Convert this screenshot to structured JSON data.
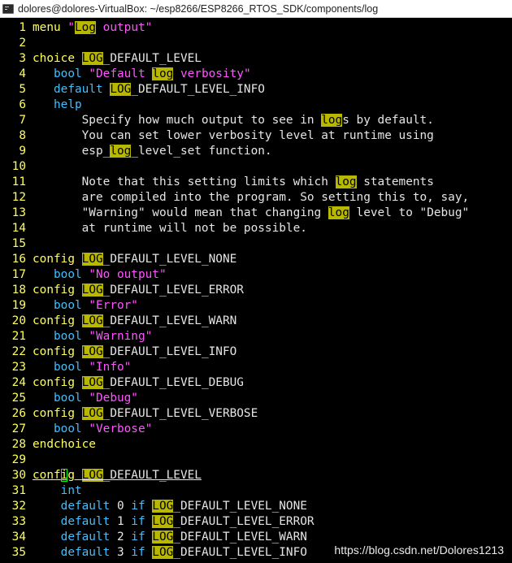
{
  "window": {
    "title": "dolores@dolores-VirtualBox: ~/esp8266/ESP8266_RTOS_SDK/components/log",
    "icon": "terminal-icon"
  },
  "watermark": "https://blog.csdn.net/Dolores1213",
  "colors": {
    "background": "#000000",
    "line_number": "#ffff55",
    "search_highlight_bg": "#b8b800",
    "string": "#ff55ff",
    "keyword": "#ffff55",
    "type": "#3fbfff",
    "text": "#e5e5e5"
  },
  "search_term": "log",
  "lines": [
    {
      "n": "1",
      "segs": [
        {
          "c": "key",
          "t": "menu "
        },
        {
          "c": "str",
          "t": "\""
        },
        {
          "c": "hl",
          "t": "Log"
        },
        {
          "c": "str",
          "t": " output\""
        }
      ]
    },
    {
      "n": "2",
      "segs": []
    },
    {
      "n": "3",
      "segs": [
        {
          "c": "key",
          "t": "choice "
        },
        {
          "c": "hl",
          "t": "LOG"
        },
        {
          "c": "text",
          "t": "_DEFAULT_LEVEL"
        }
      ]
    },
    {
      "n": "4",
      "segs": [
        {
          "c": "text",
          "t": "   "
        },
        {
          "c": "type",
          "t": "bool "
        },
        {
          "c": "str",
          "t": "\"Default "
        },
        {
          "c": "hl",
          "t": "log"
        },
        {
          "c": "str",
          "t": " verbosity\""
        }
      ]
    },
    {
      "n": "5",
      "segs": [
        {
          "c": "text",
          "t": "   "
        },
        {
          "c": "type",
          "t": "default "
        },
        {
          "c": "hl",
          "t": "LOG"
        },
        {
          "c": "text",
          "t": "_DEFAULT_LEVEL_INFO"
        }
      ]
    },
    {
      "n": "6",
      "segs": [
        {
          "c": "text",
          "t": "   "
        },
        {
          "c": "type",
          "t": "help"
        }
      ]
    },
    {
      "n": "7",
      "segs": [
        {
          "c": "text",
          "t": "       Specify how much output to see in "
        },
        {
          "c": "hl",
          "t": "log"
        },
        {
          "c": "text",
          "t": "s by default."
        }
      ]
    },
    {
      "n": "8",
      "segs": [
        {
          "c": "text",
          "t": "       You can set lower verbosity level at runtime using"
        }
      ]
    },
    {
      "n": "9",
      "segs": [
        {
          "c": "text",
          "t": "       esp_"
        },
        {
          "c": "hl",
          "t": "log"
        },
        {
          "c": "text",
          "t": "_level_set function."
        }
      ]
    },
    {
      "n": "10",
      "segs": []
    },
    {
      "n": "11",
      "segs": [
        {
          "c": "text",
          "t": "       Note that this setting limits which "
        },
        {
          "c": "hl",
          "t": "log"
        },
        {
          "c": "text",
          "t": " statements"
        }
      ]
    },
    {
      "n": "12",
      "segs": [
        {
          "c": "text",
          "t": "       are compiled into the program. So setting this to, say,"
        }
      ]
    },
    {
      "n": "13",
      "segs": [
        {
          "c": "text",
          "t": "       \"Warning\" would mean that changing "
        },
        {
          "c": "hl",
          "t": "log"
        },
        {
          "c": "text",
          "t": " level to \"Debug\""
        }
      ]
    },
    {
      "n": "14",
      "segs": [
        {
          "c": "text",
          "t": "       at runtime will not be possible."
        }
      ]
    },
    {
      "n": "15",
      "segs": []
    },
    {
      "n": "16",
      "segs": [
        {
          "c": "key",
          "t": "config "
        },
        {
          "c": "hl",
          "t": "LOG"
        },
        {
          "c": "text",
          "t": "_DEFAULT_LEVEL_NONE"
        }
      ]
    },
    {
      "n": "17",
      "segs": [
        {
          "c": "text",
          "t": "   "
        },
        {
          "c": "type",
          "t": "bool "
        },
        {
          "c": "str",
          "t": "\"No output\""
        }
      ]
    },
    {
      "n": "18",
      "segs": [
        {
          "c": "key",
          "t": "config "
        },
        {
          "c": "hl",
          "t": "LOG"
        },
        {
          "c": "text",
          "t": "_DEFAULT_LEVEL_ERROR"
        }
      ]
    },
    {
      "n": "19",
      "segs": [
        {
          "c": "text",
          "t": "   "
        },
        {
          "c": "type",
          "t": "bool "
        },
        {
          "c": "str",
          "t": "\"Error\""
        }
      ]
    },
    {
      "n": "20",
      "segs": [
        {
          "c": "key",
          "t": "config "
        },
        {
          "c": "hl",
          "t": "LOG"
        },
        {
          "c": "text",
          "t": "_DEFAULT_LEVEL_WARN"
        }
      ]
    },
    {
      "n": "21",
      "segs": [
        {
          "c": "text",
          "t": "   "
        },
        {
          "c": "type",
          "t": "bool "
        },
        {
          "c": "str",
          "t": "\"Warning\""
        }
      ]
    },
    {
      "n": "22",
      "segs": [
        {
          "c": "key",
          "t": "config "
        },
        {
          "c": "hl",
          "t": "LOG"
        },
        {
          "c": "text",
          "t": "_DEFAULT_LEVEL_INFO"
        }
      ]
    },
    {
      "n": "23",
      "segs": [
        {
          "c": "text",
          "t": "   "
        },
        {
          "c": "type",
          "t": "bool "
        },
        {
          "c": "str",
          "t": "\"Info\""
        }
      ]
    },
    {
      "n": "24",
      "segs": [
        {
          "c": "key",
          "t": "config "
        },
        {
          "c": "hl",
          "t": "LOG"
        },
        {
          "c": "text",
          "t": "_DEFAULT_LEVEL_DEBUG"
        }
      ]
    },
    {
      "n": "25",
      "segs": [
        {
          "c": "text",
          "t": "   "
        },
        {
          "c": "type",
          "t": "bool "
        },
        {
          "c": "str",
          "t": "\"Debug\""
        }
      ]
    },
    {
      "n": "26",
      "segs": [
        {
          "c": "key",
          "t": "config "
        },
        {
          "c": "hl",
          "t": "LOG"
        },
        {
          "c": "text",
          "t": "_DEFAULT_LEVEL_VERBOSE"
        }
      ]
    },
    {
      "n": "27",
      "segs": [
        {
          "c": "text",
          "t": "   "
        },
        {
          "c": "type",
          "t": "bool "
        },
        {
          "c": "str",
          "t": "\"Verbose\""
        }
      ]
    },
    {
      "n": "28",
      "segs": [
        {
          "c": "key",
          "t": "endchoice"
        }
      ]
    },
    {
      "n": "29",
      "segs": []
    },
    {
      "n": "30",
      "cursorline": true,
      "segs": [
        {
          "c": "key",
          "t": "conf"
        },
        {
          "c": "cursor",
          "t": "i"
        },
        {
          "c": "key",
          "t": "g "
        },
        {
          "c": "hl",
          "t": "LOG"
        },
        {
          "c": "text",
          "t": "_DEFAULT_LEVEL"
        }
      ]
    },
    {
      "n": "31",
      "segs": [
        {
          "c": "text",
          "t": "    "
        },
        {
          "c": "type",
          "t": "int"
        }
      ]
    },
    {
      "n": "32",
      "segs": [
        {
          "c": "text",
          "t": "    "
        },
        {
          "c": "type",
          "t": "default "
        },
        {
          "c": "text",
          "t": "0 "
        },
        {
          "c": "type",
          "t": "if "
        },
        {
          "c": "hl",
          "t": "LOG"
        },
        {
          "c": "text",
          "t": "_DEFAULT_LEVEL_NONE"
        }
      ]
    },
    {
      "n": "33",
      "segs": [
        {
          "c": "text",
          "t": "    "
        },
        {
          "c": "type",
          "t": "default "
        },
        {
          "c": "text",
          "t": "1 "
        },
        {
          "c": "type",
          "t": "if "
        },
        {
          "c": "hl",
          "t": "LOG"
        },
        {
          "c": "text",
          "t": "_DEFAULT_LEVEL_ERROR"
        }
      ]
    },
    {
      "n": "34",
      "segs": [
        {
          "c": "text",
          "t": "    "
        },
        {
          "c": "type",
          "t": "default "
        },
        {
          "c": "text",
          "t": "2 "
        },
        {
          "c": "type",
          "t": "if "
        },
        {
          "c": "hl",
          "t": "LOG"
        },
        {
          "c": "text",
          "t": "_DEFAULT_LEVEL_WARN"
        }
      ]
    },
    {
      "n": "35",
      "segs": [
        {
          "c": "text",
          "t": "    "
        },
        {
          "c": "type",
          "t": "default "
        },
        {
          "c": "text",
          "t": "3 "
        },
        {
          "c": "type",
          "t": "if "
        },
        {
          "c": "hl",
          "t": "LOG"
        },
        {
          "c": "text",
          "t": "_DEFAULT_LEVEL_INFO"
        }
      ]
    }
  ]
}
